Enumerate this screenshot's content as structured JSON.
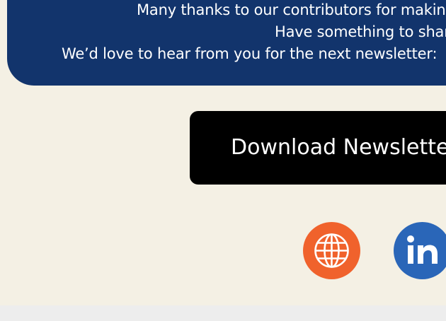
{
  "banner": {
    "line1": "Many thanks to our contributors for making",
    "line2": "Have something to share?",
    "line3": "We’d love to hear from you for the next newsletter:"
  },
  "download": {
    "label": "Download Newsletter"
  },
  "social": {
    "website_icon": "globe-icon",
    "linkedin_icon": "linkedin-icon"
  },
  "colors": {
    "banner": "#12346c",
    "page_background": "#f4f0e4",
    "button": "#000000",
    "website": "#f0622c",
    "linkedin": "#2a66b8"
  }
}
